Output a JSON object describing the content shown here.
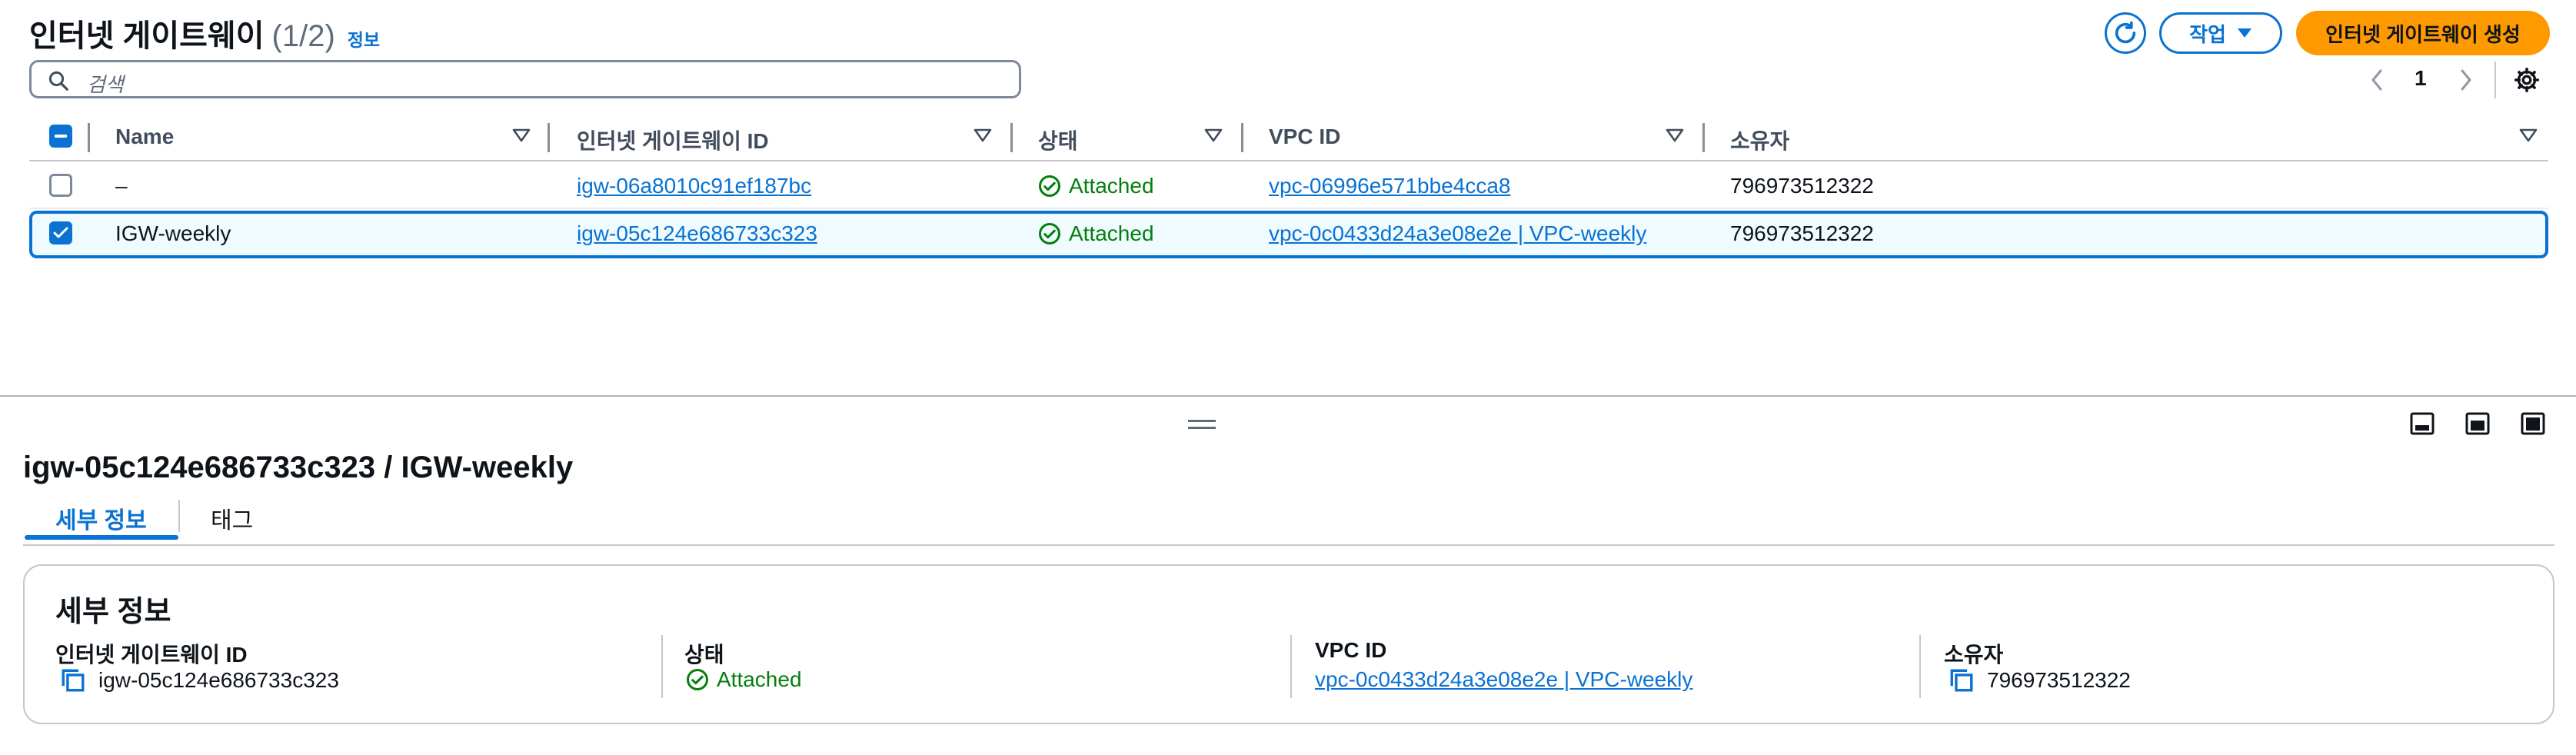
{
  "header": {
    "title": "인터넷 게이트웨이",
    "count": "(1/2)",
    "info_link": "정보",
    "actions_label": "작업",
    "create_label": "인터넷 게이트웨이 생성",
    "refresh_icon": "refresh-icon",
    "colors": {
      "accent": "#0972d3",
      "primary_button": "#ff9900"
    }
  },
  "search": {
    "placeholder": "검색"
  },
  "pagination": {
    "current_page": "1"
  },
  "table": {
    "columns": [
      "Name",
      "인터넷 게이트웨이 ID",
      "상태",
      "VPC ID",
      "소유자"
    ],
    "rows": [
      {
        "selected": false,
        "name": "–",
        "id": "igw-06a8010c91ef187bc",
        "status": "Attached",
        "vpc": "vpc-06996e571bbe4cca8",
        "owner": "796973512322"
      },
      {
        "selected": true,
        "name": "IGW-weekly",
        "id": "igw-05c124e686733c323",
        "status": "Attached",
        "vpc": "vpc-0c0433d24a3e08e2e | VPC-weekly",
        "owner": "796973512322"
      }
    ]
  },
  "detail": {
    "title": "igw-05c124e686733c323 / IGW-weekly",
    "tabs": [
      "세부 정보",
      "태그"
    ],
    "active_tab": "세부 정보",
    "section_title": "세부 정보",
    "fields": {
      "id_label": "인터넷 게이트웨이 ID",
      "id_value": "igw-05c124e686733c323",
      "status_label": "상태",
      "status_value": "Attached",
      "vpc_label": "VPC ID",
      "vpc_value": "vpc-0c0433d24a3e08e2e | VPC-weekly",
      "owner_label": "소유자",
      "owner_value": "796973512322"
    }
  }
}
